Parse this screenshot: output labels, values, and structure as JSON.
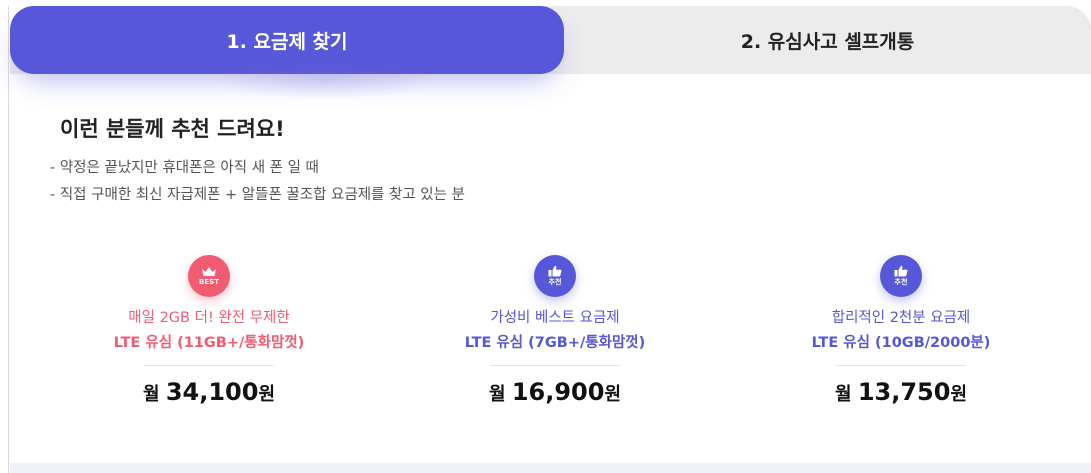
{
  "tabs": {
    "active_label": "1. 요금제 찾기",
    "inactive_label": "2. 유심사고 셀프개통"
  },
  "intro": {
    "headline": "이런 분들께 추천 드려요!",
    "bullets": [
      "약정은 끝났지만 휴대폰은 아직 새 폰 일 때",
      "직접 구매한 최신 자급제폰 + 알뜰폰 꿀조합 요금제를 찾고 있는 분"
    ]
  },
  "plans": [
    {
      "badge_icon": "crown-icon",
      "badge_text": "BEST",
      "badge_color": "#f25c73",
      "description": "매일 2GB 더! 완전 무제한",
      "name": "LTE 유심 (11GB+/통화맘껏)",
      "price_prefix": "월",
      "price": "34,100",
      "price_unit": "원"
    },
    {
      "badge_icon": "thumbs-up-icon",
      "badge_text": "추천",
      "badge_color": "#5757d9",
      "description": "가성비 베스트 요금제",
      "name": "LTE 유심 (7GB+/통화맘껏)",
      "price_prefix": "월",
      "price": "16,900",
      "price_unit": "원"
    },
    {
      "badge_icon": "thumbs-up-icon",
      "badge_text": "추천",
      "badge_color": "#5757d9",
      "description": "합리적인 2천분 요금제",
      "name": "LTE 유심 (10GB/2000분)",
      "price_prefix": "월",
      "price": "13,750",
      "price_unit": "원"
    }
  ],
  "colors": {
    "accent": "#5757d9",
    "best": "#f25c73",
    "tab_inactive_bg": "#ececec"
  }
}
